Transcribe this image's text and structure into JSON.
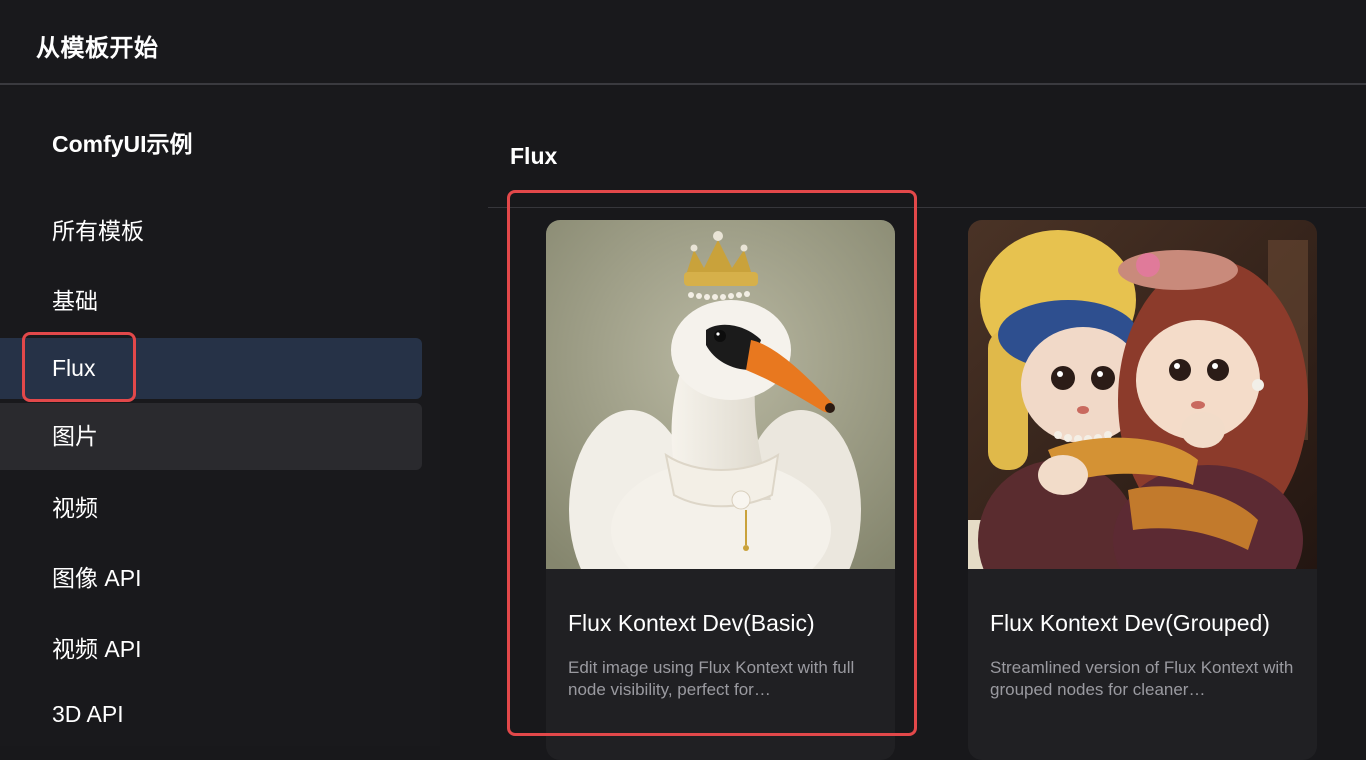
{
  "header": {
    "title": "从模板开始"
  },
  "sidebar": {
    "title": "ComfyUI示例",
    "items": [
      {
        "label": "所有模板"
      },
      {
        "label": "基础"
      },
      {
        "label": "Flux"
      },
      {
        "label": "图片"
      },
      {
        "label": "视频"
      },
      {
        "label": "图像 API"
      },
      {
        "label": "视频 API"
      },
      {
        "label": "3D API"
      }
    ],
    "active_index": 2
  },
  "main": {
    "section_title": "Flux",
    "cards": [
      {
        "title": "Flux Kontext Dev(Basic)",
        "description": "Edit image using Flux Kontext with full node visibility, perfect for…",
        "thumbnail": "swan-with-crown"
      },
      {
        "title": "Flux Kontext Dev(Grouped)",
        "description": "Streamlined version of Flux Kontext with grouped nodes for cleaner…",
        "thumbnail": "two-felt-dolls"
      }
    ]
  },
  "colors": {
    "background": "#18181b",
    "active_nav": "#263247",
    "highlight_border": "#e2484a"
  }
}
